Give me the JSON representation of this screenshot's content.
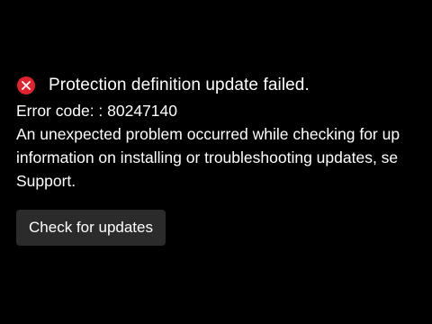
{
  "status": {
    "icon": "error-x-icon",
    "icon_color": "#e0242d",
    "title": "Protection definition update failed."
  },
  "details": {
    "error_code_line": "Error code: : 80247140",
    "message_lines": [
      "An unexpected problem occurred while checking for up",
      "information on installing or troubleshooting updates, se",
      "Support."
    ]
  },
  "actions": {
    "check_for_updates_label": "Check for updates"
  }
}
